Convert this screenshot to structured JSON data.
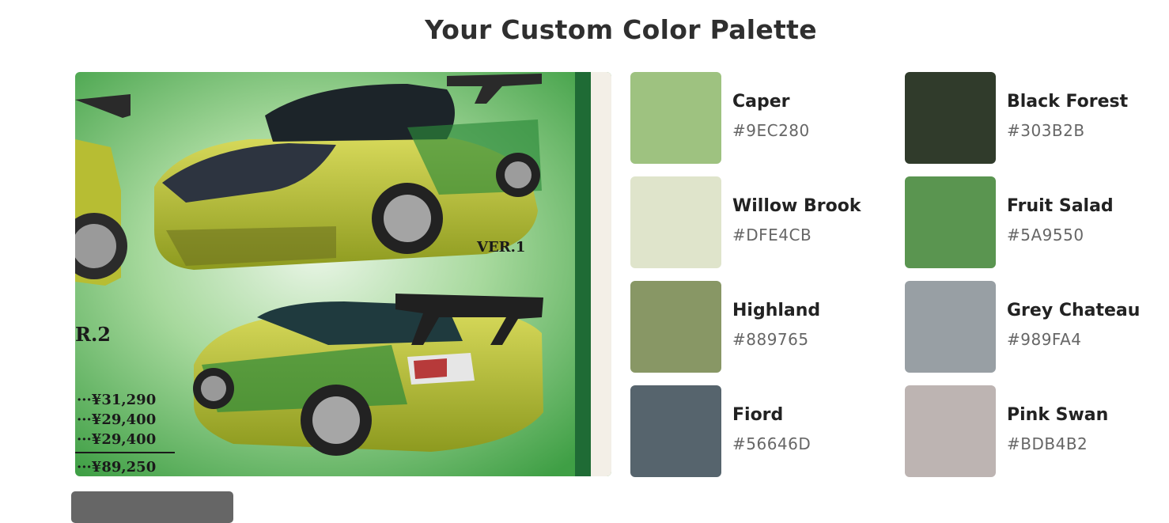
{
  "page": {
    "title": "Your Custom Color Palette"
  },
  "photo": {
    "alt": "Green sports car"
  },
  "palette": [
    {
      "name": "Caper",
      "hex": "#9EC280"
    },
    {
      "name": "Willow Brook",
      "hex": "#DFE4CB"
    },
    {
      "name": "Highland",
      "hex": "#889765"
    },
    {
      "name": "Fiord",
      "hex": "#56646D"
    },
    {
      "name": "Black Forest",
      "hex": "#303B2B"
    },
    {
      "name": "Fruit Salad",
      "hex": "#5A9550"
    },
    {
      "name": "Grey Chateau",
      "hex": "#989FA4"
    },
    {
      "name": "Pink Swan",
      "hex": "#BDB4B2"
    }
  ],
  "photo_text": {
    "ver1": "VER.1",
    "ver2": "R.2",
    "prices": [
      "···¥31,290",
      "···¥29,400",
      "···¥29,400",
      "···¥89,250"
    ]
  }
}
